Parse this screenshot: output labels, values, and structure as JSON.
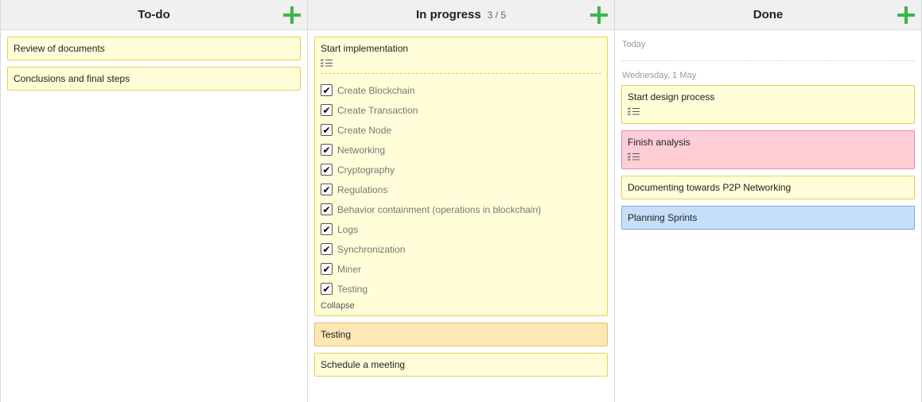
{
  "columns": {
    "todo": {
      "title": "To-do",
      "cards": [
        {
          "title": "Review of documents"
        },
        {
          "title": "Conclusions and final steps"
        }
      ]
    },
    "progress": {
      "title": "In progress",
      "count": "3 / 5",
      "expanded_card": {
        "title": "Start implementation",
        "checklist": [
          "Create Blockchain",
          "Create Transaction",
          "Create Node",
          "Networking",
          "Cryptography",
          "Regulations",
          "Behavior containment (operations in blockchain)",
          "Logs",
          "Synchronization",
          "Miner",
          "Testing"
        ],
        "collapse_label": "Collapse"
      },
      "cards": [
        {
          "title": "Testing",
          "color": "#fde7b4"
        },
        {
          "title": "Schedule a meeting",
          "color": "#fffed8"
        }
      ]
    },
    "done": {
      "title": "Done",
      "groups": [
        {
          "label": "Today"
        },
        {
          "label": "Wednesday, 1 May"
        }
      ],
      "cards": [
        {
          "title": "Start design process",
          "color": "#fffed8",
          "has_checklist": true
        },
        {
          "title": "Finish analysis",
          "color": "#ffcdd6",
          "has_checklist": true
        },
        {
          "title": "Documenting towards P2P Networking",
          "color": "#fffed8",
          "has_checklist": false
        },
        {
          "title": "Planning Sprints",
          "color": "#c5dffb",
          "has_checklist": false
        }
      ]
    }
  },
  "icons": {
    "add": "add-icon",
    "checklist": "checklist-icon",
    "check": "check-icon"
  },
  "colors": {
    "accent_green": "#3cb54a",
    "card_yellow": "#fffed8",
    "card_orange": "#fde7b4",
    "card_pink": "#ffcdd6",
    "card_blue": "#c5dffb"
  }
}
